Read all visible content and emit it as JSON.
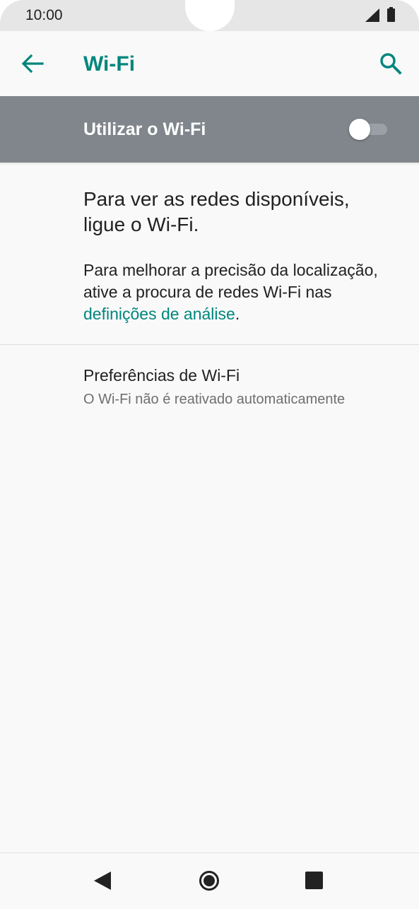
{
  "status_bar": {
    "time": "10:00",
    "icons": [
      "signal-icon",
      "battery-icon"
    ]
  },
  "app_bar": {
    "title": "Wi-Fi",
    "back_icon": "arrow-back-icon",
    "search_icon": "search-icon",
    "accent_color": "#00867d"
  },
  "wifi_toggle": {
    "label": "Utilizar o Wi-Fi",
    "state": "off",
    "background_color": "#80868b"
  },
  "main": {
    "off_message": "Para ver as redes disponíveis, ligue o Wi-Fi.",
    "location_hint_prefix": "Para melhorar a precisão da localização, ative a procura de redes Wi-Fi nas ",
    "location_hint_link": "definições de análise",
    "location_hint_suffix": "."
  },
  "preferences": {
    "title": "Preferências de Wi-Fi",
    "summary": "O Wi-Fi não é reativado automaticamente"
  },
  "nav_bar": {
    "icons": [
      "nav-back-icon",
      "nav-home-icon",
      "nav-recents-icon"
    ]
  }
}
